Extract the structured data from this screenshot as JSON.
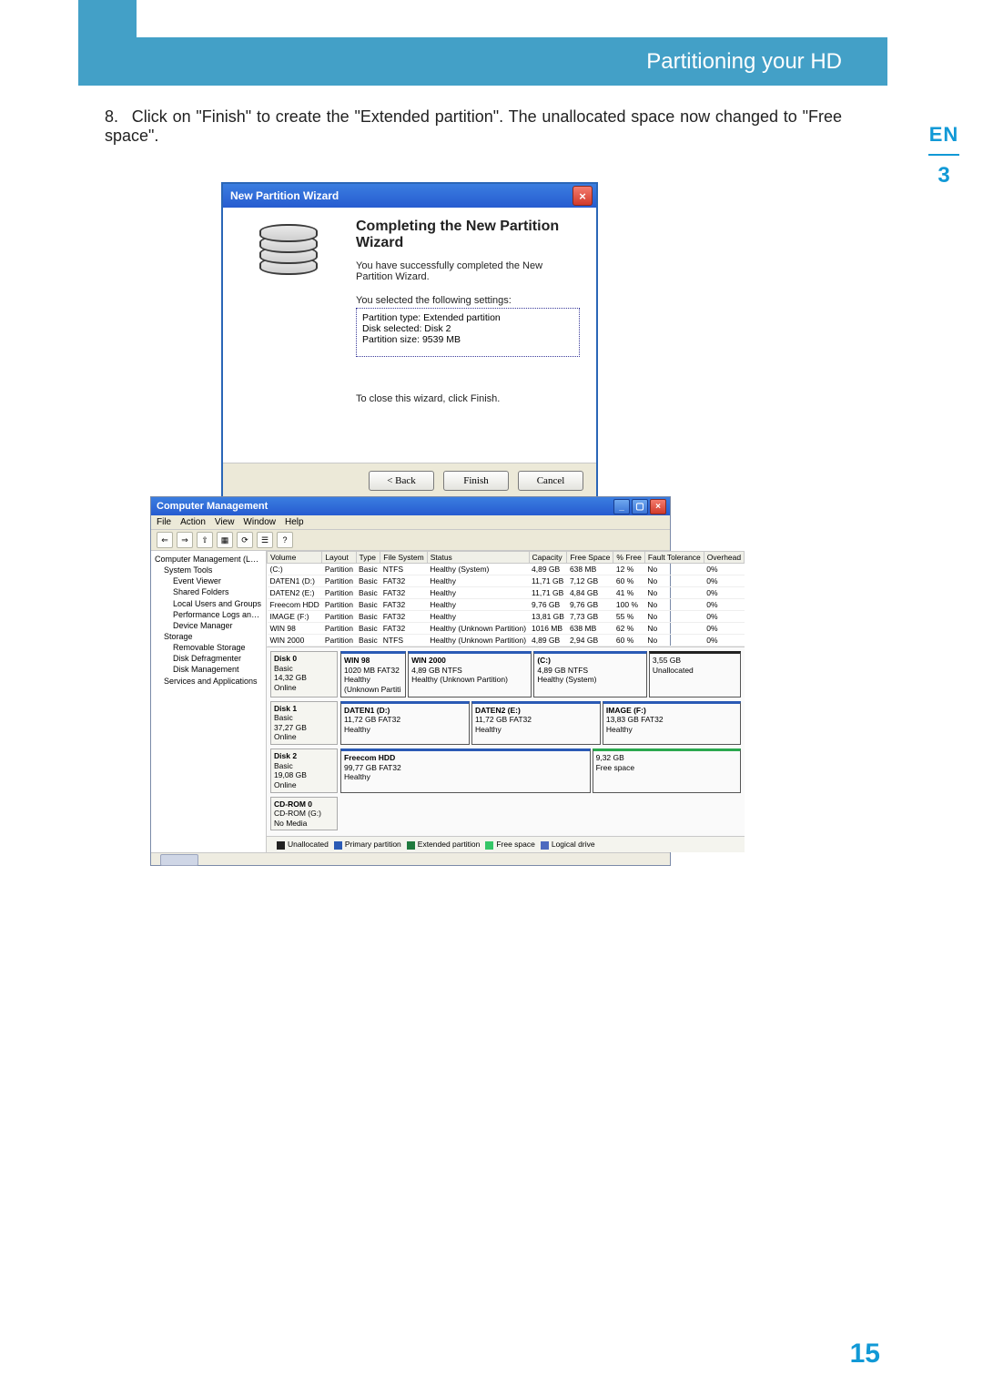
{
  "banner": {
    "title": "Partitioning your HD"
  },
  "sideTab": {
    "lang": "EN",
    "num": "3"
  },
  "step": {
    "number": "8.",
    "text": "Click on \"Finish\" to create the \"Extended partition\". The unallocated space now changed to \"Free space\"."
  },
  "wizard": {
    "window_title": "New Partition Wizard",
    "heading": "Completing the New Partition Wizard",
    "message": "You have successfully completed the New Partition Wizard.",
    "settings_label": "You selected the following settings:",
    "settings_text": "Partition type: Extended partition\nDisk selected: Disk 2\nPartition size: 9539 MB",
    "close_hint": "To close this wizard, click Finish.",
    "buttons": {
      "back": "< Back",
      "finish": "Finish",
      "cancel": "Cancel"
    }
  },
  "cm": {
    "title": "Computer Management",
    "menu": [
      "File",
      "Action",
      "View",
      "Window",
      "Help"
    ],
    "tree": [
      {
        "t": "Computer Management (Local)",
        "lvl": 0
      },
      {
        "t": "System Tools",
        "lvl": 1
      },
      {
        "t": "Event Viewer",
        "lvl": 2
      },
      {
        "t": "Shared Folders",
        "lvl": 2
      },
      {
        "t": "Local Users and Groups",
        "lvl": 2
      },
      {
        "t": "Performance Logs and Alerts",
        "lvl": 2
      },
      {
        "t": "Device Manager",
        "lvl": 2
      },
      {
        "t": "Storage",
        "lvl": 1
      },
      {
        "t": "Removable Storage",
        "lvl": 2
      },
      {
        "t": "Disk Defragmenter",
        "lvl": 2
      },
      {
        "t": "Disk Management",
        "lvl": 2
      },
      {
        "t": "Services and Applications",
        "lvl": 1
      }
    ],
    "volumes": {
      "headers": [
        "Volume",
        "Layout",
        "Type",
        "File System",
        "Status",
        "Capacity",
        "Free Space",
        "% Free",
        "Fault Tolerance",
        "Overhead"
      ],
      "rows": [
        [
          "(C:)",
          "Partition",
          "Basic",
          "NTFS",
          "Healthy (System)",
          "4,89 GB",
          "638 MB",
          "12 %",
          "No",
          "0%"
        ],
        [
          "DATEN1 (D:)",
          "Partition",
          "Basic",
          "FAT32",
          "Healthy",
          "11,71 GB",
          "7,12 GB",
          "60 %",
          "No",
          "0%"
        ],
        [
          "DATEN2 (E:)",
          "Partition",
          "Basic",
          "FAT32",
          "Healthy",
          "11,71 GB",
          "4,84 GB",
          "41 %",
          "No",
          "0%"
        ],
        [
          "Freecom HDD",
          "Partition",
          "Basic",
          "FAT32",
          "Healthy",
          "9,76 GB",
          "9,76 GB",
          "100 %",
          "No",
          "0%"
        ],
        [
          "IMAGE (F:)",
          "Partition",
          "Basic",
          "FAT32",
          "Healthy",
          "13,81 GB",
          "7,73 GB",
          "55 %",
          "No",
          "0%"
        ],
        [
          "WIN 98",
          "Partition",
          "Basic",
          "FAT32",
          "Healthy (Unknown Partition)",
          "1016 MB",
          "638 MB",
          "62 %",
          "No",
          "0%"
        ],
        [
          "WIN 2000",
          "Partition",
          "Basic",
          "NTFS",
          "Healthy (Unknown Partition)",
          "4,89 GB",
          "2,94 GB",
          "60 %",
          "No",
          "0%"
        ]
      ]
    },
    "disks": [
      {
        "name": "Disk 0",
        "type": "Basic",
        "size": "14,32 GB",
        "status": "Online",
        "slices": [
          {
            "title": "WIN 98",
            "line2": "1020 MB FAT32",
            "line3": "Healthy (Unknown Partiti",
            "color": "blue",
            "flex": 1.1
          },
          {
            "title": "WIN 2000",
            "line2": "4,89 GB NTFS",
            "line3": "Healthy (Unknown Partition)",
            "color": "blue",
            "flex": 2.2
          },
          {
            "title": "(C:)",
            "line2": "4,89 GB NTFS",
            "line3": "Healthy (System)",
            "color": "blue",
            "flex": 2.0
          },
          {
            "title": "",
            "line2": "3,55 GB",
            "line3": "Unallocated",
            "color": "none",
            "flex": 1.6
          }
        ]
      },
      {
        "name": "Disk 1",
        "type": "Basic",
        "size": "37,27 GB",
        "status": "Online",
        "slices": [
          {
            "title": "DATEN1 (D:)",
            "line2": "11,72 GB FAT32",
            "line3": "Healthy",
            "color": "blue",
            "flex": 1.3
          },
          {
            "title": "DATEN2 (E:)",
            "line2": "11,72 GB FAT32",
            "line3": "Healthy",
            "color": "blue",
            "flex": 1.3
          },
          {
            "title": "IMAGE (F:)",
            "line2": "13,83 GB FAT32",
            "line3": "Healthy",
            "color": "blue",
            "flex": 1.4
          }
        ]
      },
      {
        "name": "Disk 2",
        "type": "Basic",
        "size": "19,08 GB",
        "status": "Online",
        "slices": [
          {
            "title": "Freecom HDD",
            "line2": "99,77 GB FAT32",
            "line3": "Healthy",
            "color": "blue",
            "flex": 2.4
          },
          {
            "title": "",
            "line2": "9,32 GB",
            "line3": "Free space",
            "color": "green",
            "flex": 1.4
          }
        ]
      },
      {
        "name": "CD-ROM 0",
        "type": "CD-ROM (G:)",
        "size": "",
        "status": "No Media",
        "slices": []
      }
    ],
    "legend": {
      "items": [
        {
          "label": "Unallocated",
          "color": "#222"
        },
        {
          "label": "Primary partition",
          "color": "#2a5ab5"
        },
        {
          "label": "Extended partition",
          "color": "#1f7a3e"
        },
        {
          "label": "Free space",
          "color": "#35c667"
        },
        {
          "label": "Logical drive",
          "color": "#4e6bbf"
        }
      ]
    }
  },
  "pageNumber": "15"
}
